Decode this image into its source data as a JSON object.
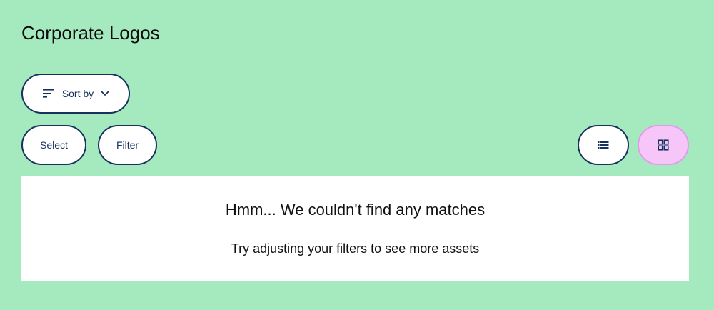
{
  "page": {
    "title": "Corporate Logos"
  },
  "toolbar": {
    "sort_label": "Sort by",
    "select_label": "Select",
    "filter_label": "Filter",
    "sort_icon": "sort-lines-icon",
    "sort_chevron_icon": "chevron-down-icon",
    "list_view_icon": "list-view-icon",
    "grid_view_icon": "grid-view-icon",
    "active_view": "grid"
  },
  "empty_state": {
    "title": "Hmm... We couldn't find any matches",
    "subtitle": "Try adjusting your filters to see more assets"
  },
  "colors": {
    "background": "#a5e9bf",
    "button_border": "#16315c",
    "active_view_fill": "#f6c6f9",
    "active_view_border": "#e39be9",
    "panel": "#ffffff"
  }
}
